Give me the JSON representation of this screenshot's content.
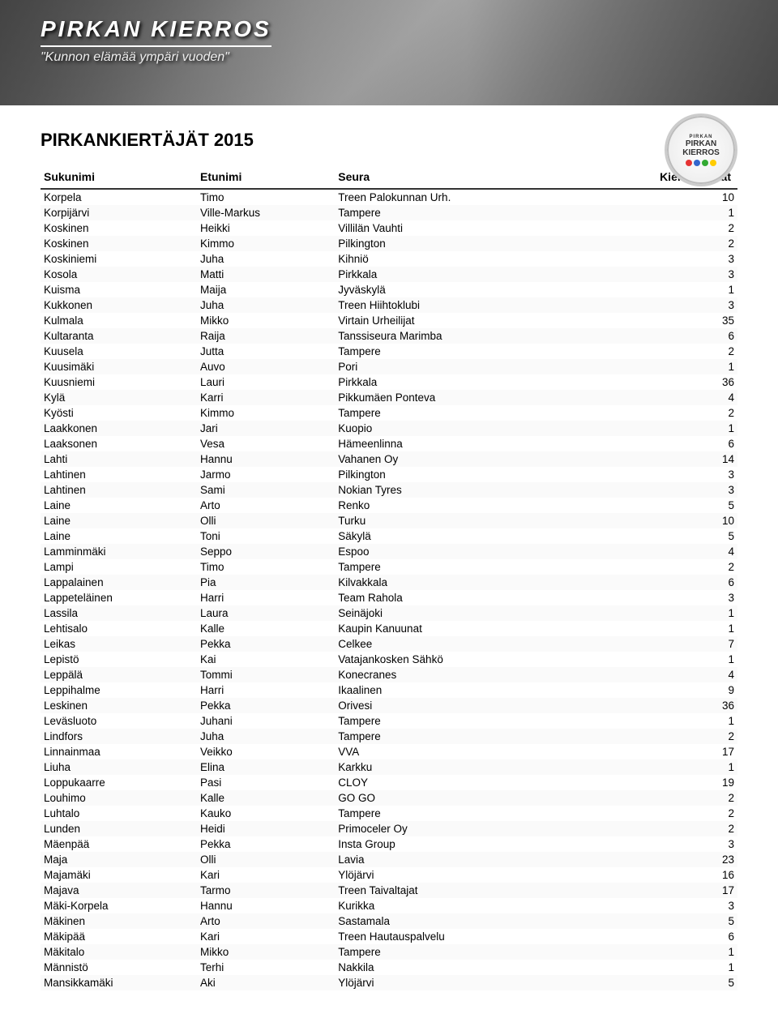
{
  "header": {
    "title": "PIRKAN KIERROS",
    "subtitle": "\"Kunnon elämää ympäri vuoden\""
  },
  "page_title": "PIRKANKIERTÄJÄT 2015",
  "logo": {
    "text_top": "PIRKAN KIERROS",
    "text_main": "PIRKAN\nKIERROS",
    "dots": [
      {
        "color": "#e63333"
      },
      {
        "color": "#3366cc"
      },
      {
        "color": "#33aa33"
      },
      {
        "color": "#ffcc00"
      }
    ]
  },
  "table": {
    "headers": [
      "Sukunimi",
      "Etunimi",
      "Seura",
      "Kierroskerrat"
    ],
    "rows": [
      [
        "Korpela",
        "Timo",
        "Treen Palokunnan Urh.",
        "10"
      ],
      [
        "Korpijärvi",
        "Ville-Markus",
        "Tampere",
        "1"
      ],
      [
        "Koskinen",
        "Heikki",
        "Villilän Vauhti",
        "2"
      ],
      [
        "Koskinen",
        "Kimmo",
        "Pilkington",
        "2"
      ],
      [
        "Koskiniemi",
        "Juha",
        "Kihniö",
        "3"
      ],
      [
        "Kosola",
        "Matti",
        "Pirkkala",
        "3"
      ],
      [
        "Kuisma",
        "Maija",
        "Jyväskylä",
        "1"
      ],
      [
        "Kukkonen",
        "Juha",
        "Treen Hiihtoklubi",
        "3"
      ],
      [
        "Kulmala",
        "Mikko",
        "Virtain Urheilijat",
        "35"
      ],
      [
        "Kultaranta",
        "Raija",
        "Tanssiseura Marimba",
        "6"
      ],
      [
        "Kuusela",
        "Jutta",
        "Tampere",
        "2"
      ],
      [
        "Kuusimäki",
        "Auvo",
        "Pori",
        "1"
      ],
      [
        "Kuusniemi",
        "Lauri",
        "Pirkkala",
        "36"
      ],
      [
        "Kylä",
        "Karri",
        "Pikkumäen Ponteva",
        "4"
      ],
      [
        "Kyösti",
        "Kimmo",
        "Tampere",
        "2"
      ],
      [
        "Laakkonen",
        "Jari",
        "Kuopio",
        "1"
      ],
      [
        "Laaksonen",
        "Vesa",
        "Hämeenlinna",
        "6"
      ],
      [
        "Lahti",
        "Hannu",
        "Vahanen Oy",
        "14"
      ],
      [
        "Lahtinen",
        "Jarmo",
        "Pilkington",
        "3"
      ],
      [
        "Lahtinen",
        "Sami",
        "Nokian Tyres",
        "3"
      ],
      [
        "Laine",
        "Arto",
        "Renko",
        "5"
      ],
      [
        "Laine",
        "Olli",
        "Turku",
        "10"
      ],
      [
        "Laine",
        "Toni",
        "Säkylä",
        "5"
      ],
      [
        "Lamminmäki",
        "Seppo",
        "Espoo",
        "4"
      ],
      [
        "Lampi",
        "Timo",
        "Tampere",
        "2"
      ],
      [
        "Lappalainen",
        "Pia",
        "Kilvakkala",
        "6"
      ],
      [
        "Lappeteläinen",
        "Harri",
        "Team Rahola",
        "3"
      ],
      [
        "Lassila",
        "Laura",
        "Seinäjoki",
        "1"
      ],
      [
        "Lehtisalo",
        "Kalle",
        "Kaupin Kanuunat",
        "1"
      ],
      [
        "Leikas",
        "Pekka",
        "Celkee",
        "7"
      ],
      [
        "Lepistö",
        "Kai",
        "Vatajankosken Sähkö",
        "1"
      ],
      [
        "Leppälä",
        "Tommi",
        "Konecranes",
        "4"
      ],
      [
        "Leppihalme",
        "Harri",
        "Ikaalinen",
        "9"
      ],
      [
        "Leskinen",
        "Pekka",
        "Orivesi",
        "36"
      ],
      [
        "Leväsluoto",
        "Juhani",
        "Tampere",
        "1"
      ],
      [
        "Lindfors",
        "Juha",
        "Tampere",
        "2"
      ],
      [
        "Linnainmaa",
        "Veikko",
        "VVA",
        "17"
      ],
      [
        "Liuha",
        "Elina",
        "Karkku",
        "1"
      ],
      [
        "Loppukaarre",
        "Pasi",
        "CLOY",
        "19"
      ],
      [
        "Louhimo",
        "Kalle",
        "GO GO",
        "2"
      ],
      [
        "Luhtalo",
        "Kauko",
        "Tampere",
        "2"
      ],
      [
        "Lunden",
        "Heidi",
        "Primoceler Oy",
        "2"
      ],
      [
        "Mäenpää",
        "Pekka",
        "Insta Group",
        "3"
      ],
      [
        "Maja",
        "Olli",
        "Lavia",
        "23"
      ],
      [
        "Majamäki",
        "Kari",
        "Ylöjärvi",
        "16"
      ],
      [
        "Majava",
        "Tarmo",
        "Treen Taivaltajat",
        "17"
      ],
      [
        "Mäki-Korpela",
        "Hannu",
        "Kurikka",
        "3"
      ],
      [
        "Mäkinen",
        "Arto",
        "Sastamala",
        "5"
      ],
      [
        "Mäkipää",
        "Kari",
        "Treen Hautauspalvelu",
        "6"
      ],
      [
        "Mäkitalo",
        "Mikko",
        "Tampere",
        "1"
      ],
      [
        "Männistö",
        "Terhi",
        "Nakkila",
        "1"
      ],
      [
        "Mansikkamäki",
        "Aki",
        "Ylöjärvi",
        "5"
      ]
    ]
  }
}
